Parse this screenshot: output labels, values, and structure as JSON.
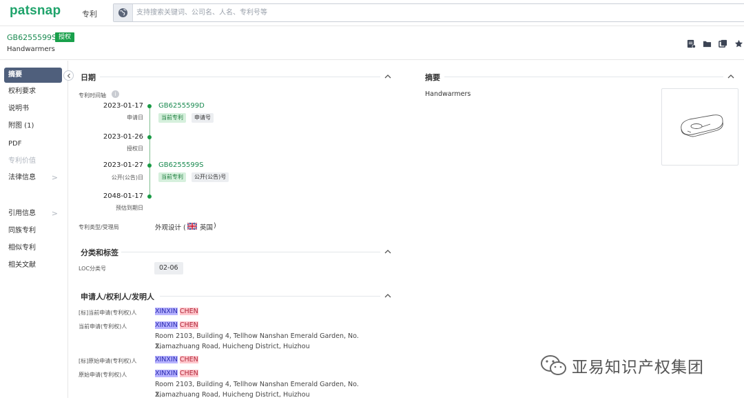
{
  "app": {
    "logo": "patsnap",
    "module": "专利"
  },
  "search": {
    "placeholder": "支持搜索关键词、公司名、人名、专利号等"
  },
  "patent": {
    "number": "GB6255599S",
    "status": "授权",
    "title": "Handwarmers"
  },
  "header_icons": [
    "pdf-export-icon",
    "folder-icon",
    "compare-icon",
    "star-icon"
  ],
  "sidebar": {
    "items": [
      {
        "label": "摘要",
        "active": true
      },
      {
        "label": "权利要求"
      },
      {
        "label": "说明书"
      },
      {
        "label": "附图 (1)"
      },
      {
        "label": "PDF"
      },
      {
        "label": "专利价值",
        "disabled": true
      },
      {
        "label": "法律信息",
        "chevron": ">"
      },
      {
        "label": "引用信息",
        "chevron": ">"
      },
      {
        "label": "同族专利"
      },
      {
        "label": "相似专利"
      },
      {
        "label": "相关文献"
      }
    ]
  },
  "dates": {
    "title": "日期",
    "timeline_label": "专利时间轴",
    "events": [
      {
        "date": "2023-01-17",
        "sub": "申请日",
        "link": "GB6255599D",
        "tags": [
          "当前专利",
          "申请号"
        ]
      },
      {
        "date": "2023-01-26",
        "sub": "授权日"
      },
      {
        "date": "2023-01-27",
        "sub": "公开(公告)日",
        "link": "GB6255599S",
        "tags": [
          "当前专利",
          "公开(公告)号"
        ]
      },
      {
        "date": "2048-01-17",
        "sub": "预估到期日"
      }
    ],
    "type_label": "专利类型/受理局",
    "type_value": "外观设计 (",
    "country": "英国",
    "type_close": ")"
  },
  "classification": {
    "title": "分类和标签",
    "loc_label": "LOC分类号",
    "loc_value": "02-06"
  },
  "parties": {
    "title": "申请人/权利人/发明人",
    "rows": [
      {
        "label": "[标]当前申请(专利权)人",
        "first": "XINXIN",
        "last": "CHEN"
      },
      {
        "label": "当前申请(专利权)人",
        "first": "XINXIN",
        "last": "CHEN",
        "addr1": "Room 2103, Building 4, Tellhow Nanshan Emerald Garden, No. 2,",
        "addr2": "Xiamazhuang Road, Huicheng District, Huizhou"
      },
      {
        "label": "[标]原始申请(专利权)人",
        "first": "XINXIN",
        "last": "CHEN"
      },
      {
        "label": "原始申请(专利权)人",
        "first": "XINXIN",
        "last": "CHEN",
        "addr1": "Room 2103, Building 4, Tellhow Nanshan Emerald Garden, No. 2,",
        "addr2": "Xiamazhuang Road, Huicheng District, Huizhou"
      }
    ]
  },
  "abstract": {
    "title": "摘要",
    "text": "Handwarmers"
  },
  "watermark": {
    "text": "亚易知识产权集团"
  },
  "colors": {
    "brand": "#1fa36b",
    "active_nav": "#4f5f7c",
    "status_badge": "#19a04b"
  }
}
